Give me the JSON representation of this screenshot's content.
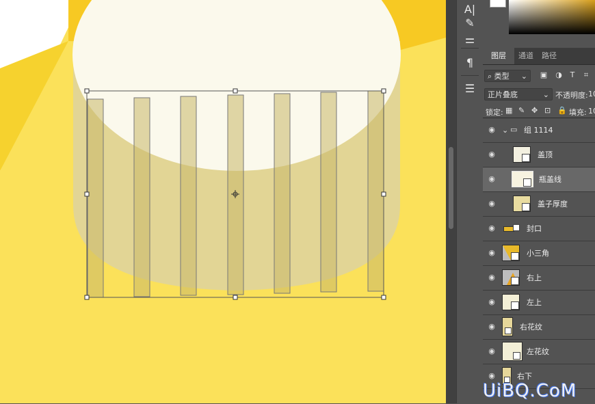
{
  "colors": {
    "accent_yellow": "#fbe15a",
    "cap_white": "#fbf9ec",
    "cap_side": "#e2d595",
    "stripe": "#c9b86a"
  },
  "toolbar": {
    "icons": [
      "type-icon",
      "brush-icon",
      "adjust-icon",
      "paragraph-icon",
      "sliders-icon"
    ]
  },
  "panel_tabs": [
    "图层",
    "通道",
    "路径"
  ],
  "filter": {
    "label": "类型"
  },
  "blend": {
    "mode": "正片叠底",
    "opacity_label": "不透明度:",
    "opacity_value": "10"
  },
  "lock": {
    "label": "锁定:",
    "fill_label": "填充:",
    "fill_value": "10"
  },
  "layers": [
    {
      "name": "组 1114",
      "type": "group"
    },
    {
      "name": "盖顶",
      "type": "layer"
    },
    {
      "name": "瓶盖线",
      "type": "layer",
      "selected": true
    },
    {
      "name": "盖子厚度",
      "type": "layer"
    },
    {
      "name": "封口",
      "type": "layer"
    },
    {
      "name": "小三角",
      "type": "layer"
    },
    {
      "name": "右上",
      "type": "layer"
    },
    {
      "name": "左上",
      "type": "layer"
    },
    {
      "name": "右花纹",
      "type": "layer"
    },
    {
      "name": "左花纹",
      "type": "layer"
    },
    {
      "name": "右下",
      "type": "layer"
    }
  ],
  "watermark": "UiBQ.CoM"
}
